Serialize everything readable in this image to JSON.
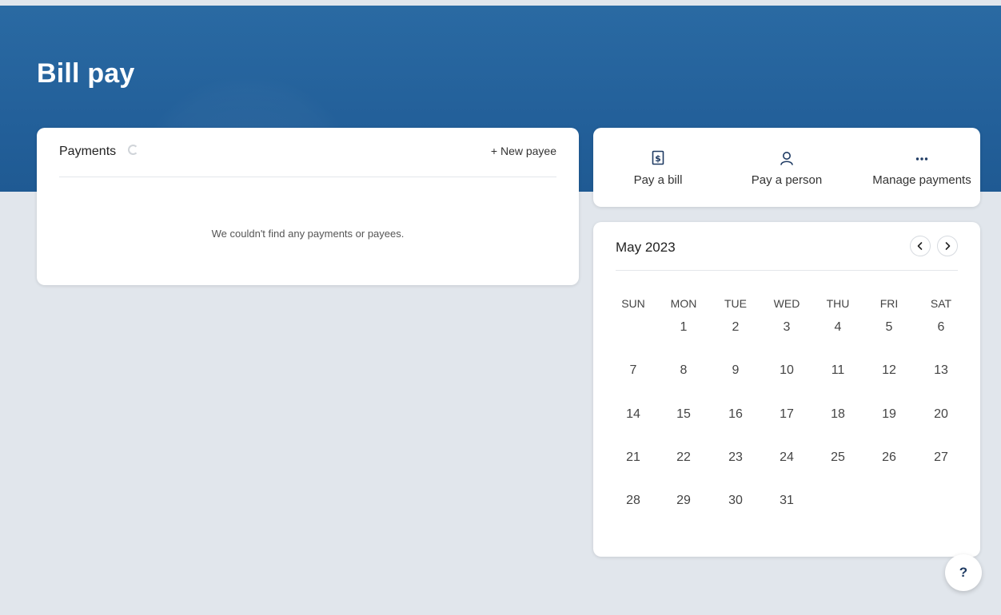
{
  "page": {
    "title": "Bill pay"
  },
  "payments": {
    "title": "Payments",
    "new_payee_label": "+ New payee",
    "empty_message": "We couldn't find any payments or payees."
  },
  "actions": [
    {
      "label": "Pay a bill",
      "icon": "bill-dollar-icon"
    },
    {
      "label": "Pay a person",
      "icon": "person-icon"
    },
    {
      "label": "Manage payments",
      "icon": "more-horizontal-icon"
    }
  ],
  "calendar": {
    "month_label": "May 2023",
    "weekdays": [
      "SUN",
      "MON",
      "TUE",
      "WED",
      "THU",
      "FRI",
      "SAT"
    ],
    "first_weekday_index": 1,
    "days": [
      "1",
      "2",
      "3",
      "4",
      "5",
      "6",
      "7",
      "8",
      "9",
      "10",
      "11",
      "12",
      "13",
      "14",
      "15",
      "16",
      "17",
      "18",
      "19",
      "20",
      "21",
      "22",
      "23",
      "24",
      "25",
      "26",
      "27",
      "28",
      "29",
      "30",
      "31"
    ]
  },
  "help": {
    "label": "?"
  },
  "colors": {
    "banner": "#23609a",
    "background": "#e1e6ec",
    "card": "#ffffff",
    "help_text": "#1f3b63"
  }
}
